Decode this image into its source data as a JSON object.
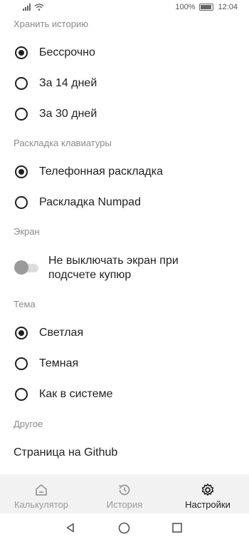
{
  "status_bar": {
    "battery": "100%",
    "time": "12:04"
  },
  "sections": {
    "history": {
      "title": "Хранить историю",
      "options": [
        {
          "label": "Бессрочно",
          "checked": true
        },
        {
          "label": "За 14 дней",
          "checked": false
        },
        {
          "label": "За 30 дней",
          "checked": false
        }
      ]
    },
    "keyboard": {
      "title": "Раскладка клавиатуры",
      "options": [
        {
          "label": "Телефонная раскладка",
          "checked": true
        },
        {
          "label": "Раскладка Numpad",
          "checked": false
        }
      ]
    },
    "screen": {
      "title": "Экран",
      "toggle_line1": "Не выключать экран при",
      "toggle_line2": "подсчете купюр",
      "toggle_on": false
    },
    "theme": {
      "title": "Тема",
      "options": [
        {
          "label": "Светлая",
          "checked": true
        },
        {
          "label": "Темная",
          "checked": false
        },
        {
          "label": "Как в системе",
          "checked": false
        }
      ]
    },
    "other": {
      "title": "Другое",
      "github_link": "Страница на Github"
    }
  },
  "bottom_nav": {
    "items": [
      {
        "label": "Калькулятор",
        "icon": "home-icon",
        "active": false
      },
      {
        "label": "История",
        "icon": "history-icon",
        "active": false
      },
      {
        "label": "Настройки",
        "icon": "gear-icon",
        "active": true
      }
    ]
  },
  "system_nav": {
    "icons": [
      "back-icon",
      "home-circle-icon",
      "recents-icon"
    ]
  },
  "colors": {
    "text": "#1f1f1f",
    "muted": "#8a8a8a",
    "nav_bg": "#f2f2f2"
  }
}
